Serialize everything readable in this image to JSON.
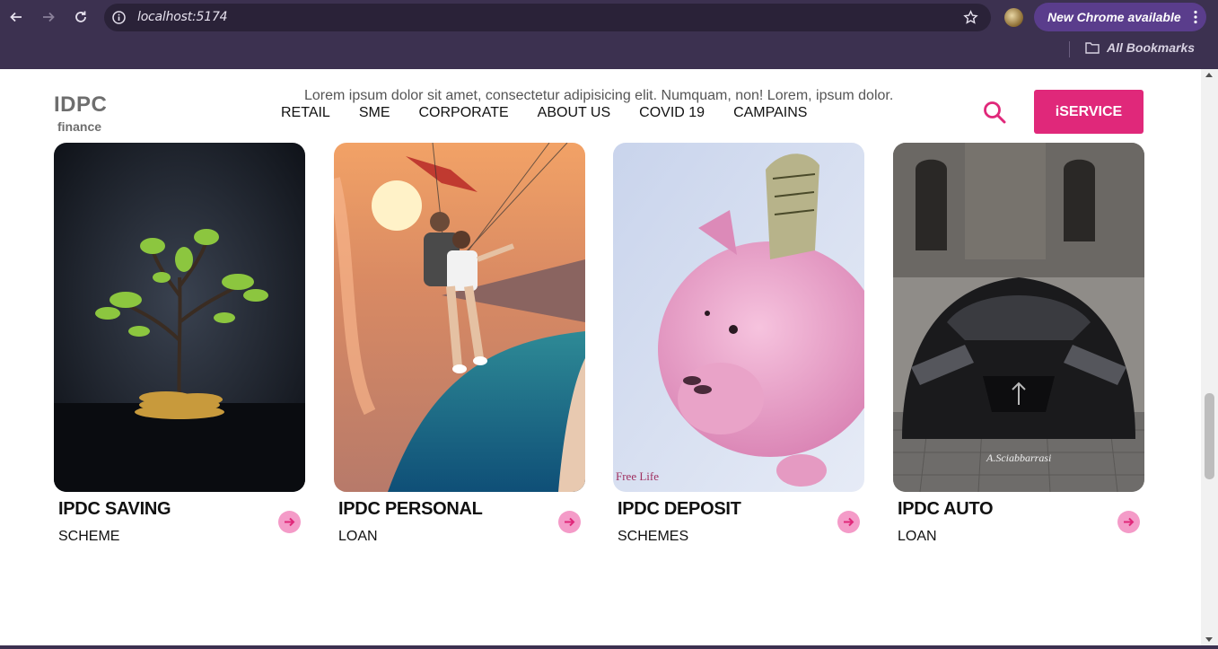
{
  "browser": {
    "url": "localhost:5174",
    "update_label": "New Chrome available",
    "bookmarks_label": "All Bookmarks"
  },
  "site": {
    "logo_main": "IDPC",
    "logo_sub": "finance",
    "tagline": "Lorem ipsum dolor sit amet, consectetur adipisicing elit. Numquam, non! Lorem, ipsum dolor.",
    "nav": [
      "RETAIL",
      "SME",
      "CORPORATE",
      "ABOUT US",
      "COVID 19",
      "CAMPAINS"
    ],
    "cta_label": "iSERVICE",
    "accent": "#e0287a",
    "arrow_bg": "#f49bc8"
  },
  "cards": [
    {
      "title": "IPDC SAVING",
      "subtitle": "SCHEME",
      "image": "plant-coins-image"
    },
    {
      "title": "IPDC PERSONAL",
      "subtitle": "LOAN",
      "image": "paraglider-image"
    },
    {
      "title": "IPDC DEPOSIT",
      "subtitle": "SCHEMES",
      "image": "piggy-bank-image",
      "caption": "Free Life"
    },
    {
      "title": "IPDC AUTO",
      "subtitle": "LOAN",
      "image": "sports-car-image",
      "caption": "A.Sciabbarrasi"
    }
  ]
}
